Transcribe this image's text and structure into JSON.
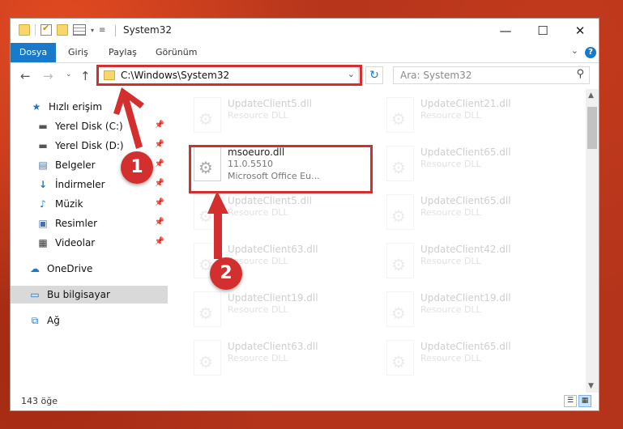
{
  "window": {
    "title": "System32"
  },
  "ribbon": {
    "tabs": [
      "Dosya",
      "Giriş",
      "Paylaş",
      "Görünüm"
    ]
  },
  "address": {
    "path": "C:\\Windows\\System32"
  },
  "search": {
    "placeholder": "Ara: System32"
  },
  "sidebar": {
    "items": [
      {
        "label": "Hızlı erişim",
        "icon": "star-icon"
      },
      {
        "label": "Yerel Disk (C:)",
        "icon": "drive-icon",
        "pinned": true
      },
      {
        "label": "Yerel Disk (D:)",
        "icon": "drive-icon",
        "pinned": true
      },
      {
        "label": "Belgeler",
        "icon": "documents-icon",
        "pinned": true
      },
      {
        "label": "İndirmeler",
        "icon": "download-icon",
        "pinned": true
      },
      {
        "label": "Müzik",
        "icon": "music-icon",
        "pinned": true
      },
      {
        "label": "Resimler",
        "icon": "pictures-icon",
        "pinned": true
      },
      {
        "label": "Videolar",
        "icon": "video-icon",
        "pinned": true
      },
      {
        "label": "OneDrive",
        "icon": "cloud-icon"
      },
      {
        "label": "Bu bilgisayar",
        "icon": "computer-icon",
        "selected": true
      },
      {
        "label": "Ağ",
        "icon": "network-icon"
      }
    ]
  },
  "files": [
    {
      "name": "UpdateClient5.dll",
      "line2": "Resource DLL",
      "line3": "",
      "faded": true
    },
    {
      "name": "UpdateClient21.dll",
      "line2": "Resource DLL",
      "line3": "",
      "faded": true
    },
    {
      "name": "msoeuro.dll",
      "line2": "11.0.5510",
      "line3": "Microsoft Office Eu...",
      "faded": false
    },
    {
      "name": "UpdateClient65.dll",
      "line2": "Resource DLL",
      "line3": "",
      "faded": true
    },
    {
      "name": "UpdateClient5.dll",
      "line2": "Resource DLL",
      "line3": "",
      "faded": true
    },
    {
      "name": "UpdateClient65.dll",
      "line2": "Resource DLL",
      "line3": "",
      "faded": true
    },
    {
      "name": "UpdateClient63.dll",
      "line2": "Resource DLL",
      "line3": "",
      "faded": true
    },
    {
      "name": "UpdateClient42.dll",
      "line2": "Resource DLL",
      "line3": "",
      "faded": true
    },
    {
      "name": "UpdateClient19.dll",
      "line2": "Resource DLL",
      "line3": "",
      "faded": true
    },
    {
      "name": "UpdateClient19.dll",
      "line2": "Resource DLL",
      "line3": "",
      "faded": true
    },
    {
      "name": "UpdateClient63.dll",
      "line2": "Resource DLL",
      "line3": "",
      "faded": true
    },
    {
      "name": "UpdateClient65.dll",
      "line2": "Resource DLL",
      "line3": "",
      "faded": true
    }
  ],
  "status": {
    "item_count": "143 öğe"
  },
  "callouts": [
    "1",
    "2"
  ],
  "colors": {
    "accent": "#1979ca",
    "highlight": "#d32f2f",
    "selected_bg": "#d9d9d9"
  }
}
